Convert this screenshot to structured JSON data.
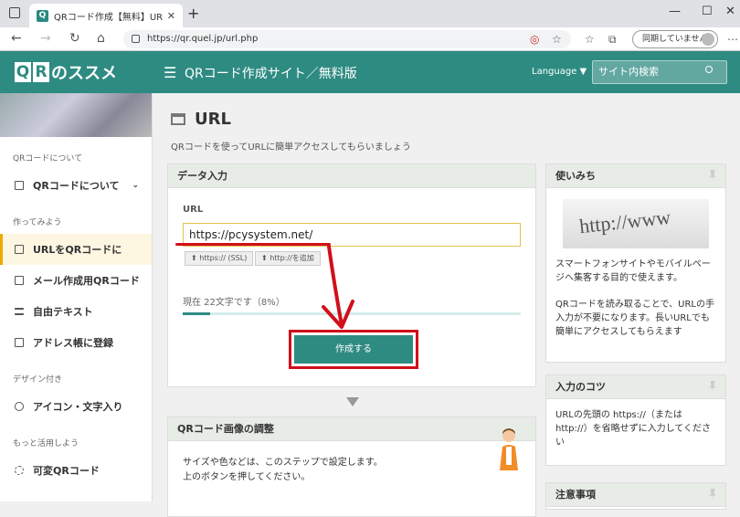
{
  "browser": {
    "tab_title": "QRコード作成【無料】URLをQRコード",
    "url": "https://qr.quel.jp/url.php",
    "sync_label": "同期していません"
  },
  "header": {
    "logo_text": "のススメ",
    "site_title": "QRコード作成サイト／無料版",
    "language_label": "Language ▼",
    "search_placeholder": "サイト内検索"
  },
  "sidebar": {
    "sections": [
      {
        "label": "QRコードについて",
        "items": [
          {
            "label": "QRコードについて"
          }
        ]
      },
      {
        "label": "作ってみよう",
        "items": [
          {
            "label": "URLをQRコードに"
          },
          {
            "label": "メール作成用QRコード"
          },
          {
            "label": "自由テキスト"
          },
          {
            "label": "アドレス帳に登録"
          }
        ]
      },
      {
        "label": "デザイン付き",
        "items": [
          {
            "label": "アイコン・文字入り"
          }
        ]
      },
      {
        "label": "もっと活用しよう",
        "items": [
          {
            "label": "可変QRコード"
          }
        ]
      }
    ]
  },
  "main": {
    "title": "URL",
    "description": "QRコードを使ってURLに簡単アクセスしてもらいましょう",
    "data_input": {
      "heading": "データ入力",
      "field_label": "URL",
      "url_value": "https://pcysystem.net/",
      "ssl_button": "⬆ https:// (SSL)",
      "http_button": "⬆ http://を追加",
      "count_text": "現在 22文字です（8%）",
      "progress_percent": 8,
      "create_button": "作成する"
    },
    "adjust": {
      "heading": "QRコード画像の調整",
      "line1": "サイズや色などは、このステップで設定します。",
      "line2": "上のボタンを押してください。"
    },
    "usage": {
      "heading": "使いみち",
      "image_text": "http://www",
      "p1": "スマートフォンサイトやモバイルページへ集客する目的で使えます。",
      "p2": "QRコードを読み取ることで、URLの手入力が不要になります。長いURLでも簡単にアクセスしてもらえます"
    },
    "tips": {
      "heading": "入力のコツ",
      "text": "URLの先頭の https://（または http://）を省略せずに入力してください"
    },
    "notes": {
      "heading": "注意事項"
    }
  }
}
